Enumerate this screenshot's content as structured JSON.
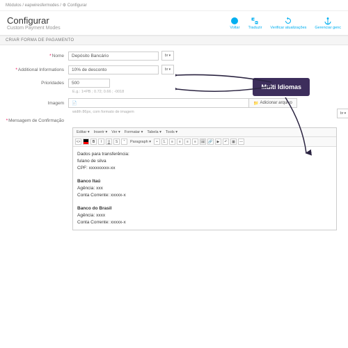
{
  "breadcrumb": "Módulos  /  eapwiresfermodes  /  ⚙ Configurar",
  "header": {
    "title": "Configurar",
    "subtitle": "Custom Payment Modes"
  },
  "actions": {
    "back": "Voltar",
    "translate": "Traduzir",
    "update": "Verificar atualizações",
    "manage": "Gerenciar genc"
  },
  "section": "CRIAR FORMA DE PAGAMENTO",
  "fields": {
    "name_lbl": "Nome",
    "name_val": "Depósito Bancário",
    "addl_lbl": "Additional Informations",
    "addl_val": "10% de desconto",
    "prio_lbl": "Prioridades",
    "prio_val": "500",
    "prio_hint": "E.g.: 1=PB ; 0.72;  0.66 ; -0018",
    "img_lbl": "Imagem",
    "img_file": "",
    "img_browse": "Adicionar arquivo",
    "img_hint": "width 86px, com formato de imagem",
    "msg_lbl": "Mensagem de Confirmação"
  },
  "lang_flag": "br ▾",
  "editor": {
    "menus": [
      "Editar ▾",
      "Inserir ▾",
      "Ver ▾",
      "Formatar ▾",
      "Tabela ▾",
      "Tools ▾"
    ],
    "body": {
      "l1": "Dados para transferência:",
      "l2": "fulano de silva",
      "l3": "CPF: xxxxxxxxx-xx",
      "l4": "",
      "b1": "Banco Itaú",
      "l5": "Agência: xxx",
      "l6": "Conta Corrente: xxxxx-x",
      "l7": "",
      "b2": "Banco do Brasil",
      "l8": "Agência: xxxx",
      "l9": "Conta Corrente: xxxxx-x"
    }
  },
  "callout": "Multi Idiomas"
}
